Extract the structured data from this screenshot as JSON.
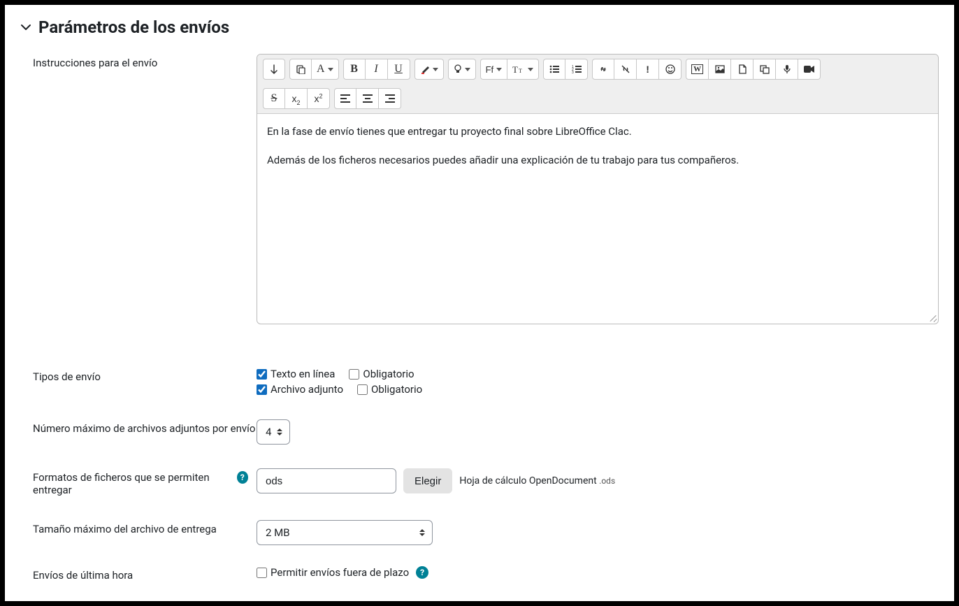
{
  "section": {
    "title": "Parámetros de los envíos"
  },
  "labels": {
    "instructions": "Instrucciones para el envío",
    "submission_types": "Tipos de envío",
    "max_files": "Número máximo de archivos adjuntos por envío",
    "allowed_formats": "Formatos de ficheros que se permiten entregar",
    "max_size": "Tamaño máximo del archivo de entrega",
    "late": "Envíos de última hora"
  },
  "editor": {
    "paragraph1": "En la fase de envío tienes que entregar tu proyecto final sobre LibreOffice Clac.",
    "paragraph2": "Además de los ficheros necesarios puedes añadir una explicación de tu trabajo para tus compañeros."
  },
  "submission_types": {
    "online_text": {
      "label": "Texto en línea",
      "checked": true
    },
    "online_text_req": {
      "label": "Obligatorio",
      "checked": false
    },
    "file": {
      "label": "Archivo adjunto",
      "checked": true
    },
    "file_req": {
      "label": "Obligatorio",
      "checked": false
    }
  },
  "max_files": {
    "value": "4"
  },
  "formats": {
    "value": "ods",
    "choose": "Elegir",
    "hint_name": "Hoja de cálculo OpenDocument ",
    "hint_ext": ".ods"
  },
  "max_size": {
    "value": "2 MB"
  },
  "late": {
    "label": "Permitir envíos fuera de plazo",
    "checked": false
  },
  "toolbar_icons": {
    "expand": "expand-icon",
    "paste": "paste-icon",
    "paragraph_style": "A",
    "bold": "B",
    "italic": "I",
    "underline": "U",
    "color": "brush-icon",
    "bulb": "lightbulb-icon",
    "font_family": "Ff",
    "font_size": "T",
    "ul": "bullet-list-icon",
    "ol": "numbered-list-icon",
    "link": "link-icon",
    "unlink": "unlink-icon",
    "warn": "!",
    "emoji": "emoji-icon",
    "w": "W",
    "image": "image-icon",
    "file": "file-icon",
    "embed": "embed-icon",
    "mic": "mic-icon",
    "video": "video-icon",
    "strike": "S",
    "sub": "x",
    "sup": "x",
    "align_left": "align-left-icon",
    "align_center": "align-center-icon",
    "align_right": "align-right-icon"
  }
}
